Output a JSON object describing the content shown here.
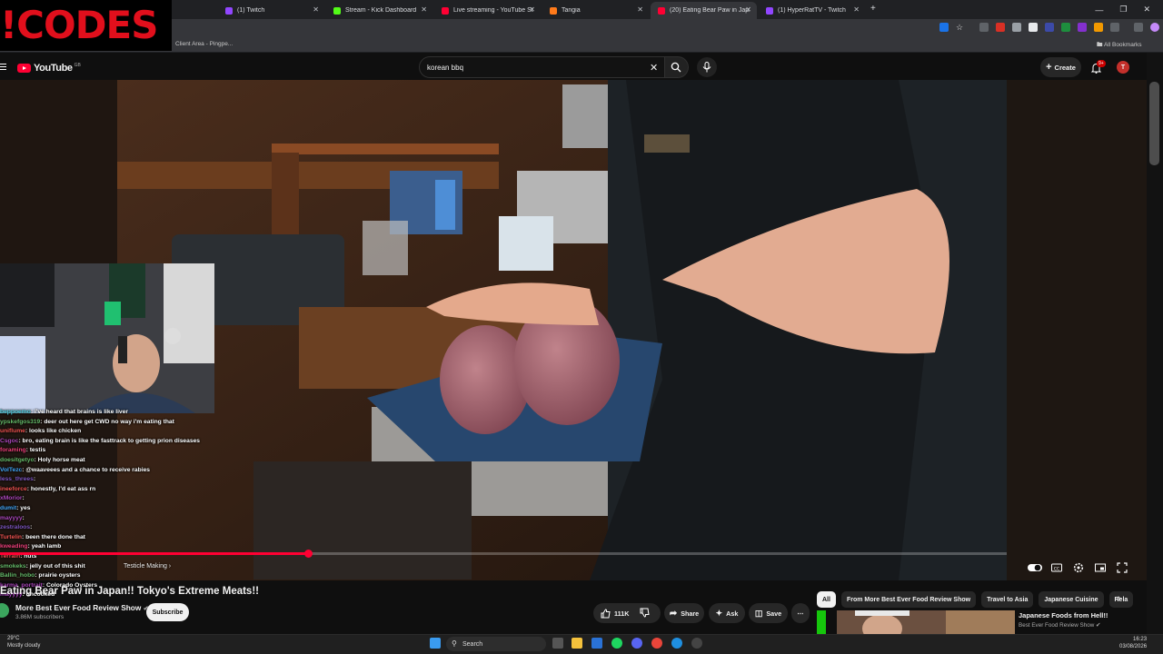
{
  "overlay": {
    "codes_text": "!CODES"
  },
  "browser": {
    "tabs": [
      {
        "label": "(1) Twitch",
        "color": "#9146ff",
        "active": false
      },
      {
        "label": "Stream - Kick Dashboard",
        "color": "#53fc18",
        "active": false
      },
      {
        "label": "Live streaming - YouTube Studio",
        "color": "#ff0033",
        "active": false
      },
      {
        "label": "Tangia",
        "color": "#ff7a1a",
        "active": false
      },
      {
        "label": "(20) Eating Bear Paw in Japa",
        "color": "#ff0033",
        "active": true
      },
      {
        "label": "(1) HyperRatTV - Twitch",
        "color": "#9146ff",
        "active": false
      }
    ],
    "new_tab": "+",
    "bookmark": "Client Area - Pingpe...",
    "all_bookmarks": "All Bookmarks"
  },
  "youtube": {
    "logo_text": "YouTube",
    "region": "GB",
    "search_value": "korean bbq",
    "create_label": "Create",
    "notif_count": "9+",
    "avatar_letter": "T"
  },
  "stream_overlay": {
    "chat": [
      {
        "user": "beppoemo",
        "ucolor": "#4dd0e1",
        "msg": "i've heard that brains is like liver"
      },
      {
        "user": "ypskefgos319",
        "ucolor": "#66bb6a",
        "msg": "deer out here get CWD no way i'm eating that"
      },
      {
        "user": "uniflume",
        "ucolor": "#ef5350",
        "msg": "looks like chicken"
      },
      {
        "user": "Csgoc",
        "ucolor": "#ab47bc",
        "msg": "bro, eating brain is like the fasttrack to getting prion diseases"
      },
      {
        "user": "foraming",
        "ucolor": "#ec407a",
        "msg": "testis"
      },
      {
        "user": "doesitgetyo",
        "ucolor": "#66bb6a",
        "msg": "Holy horse meat"
      },
      {
        "user": "VolTezc",
        "ucolor": "#42a5f5",
        "msg": "@waaveees and a chance to receive rabies"
      },
      {
        "user": "less_threes",
        "ucolor": "#7e57c2",
        "msg": ""
      },
      {
        "user": "ineeforce",
        "ucolor": "#ef5350",
        "msg": "honestly, I'd eat ass rn"
      },
      {
        "user": "xMorior",
        "ucolor": "#ab47bc",
        "msg": ""
      },
      {
        "user": "dumit",
        "ucolor": "#42a5f5",
        "msg": "yes"
      },
      {
        "user": "mayyyy",
        "ucolor": "#ab47bc",
        "msg": ""
      },
      {
        "user": "zestraloos",
        "ucolor": "#7e57c2",
        "msg": ""
      },
      {
        "user": "Turtelin",
        "ucolor": "#ef5350",
        "msg": "been there done that"
      },
      {
        "user": "kweading",
        "ucolor": "#ec407a",
        "msg": "yeah lamb"
      },
      {
        "user": "Terrain",
        "ucolor": "#ef5350",
        "msg": "nuts"
      },
      {
        "user": "smokeks",
        "ucolor": "#66bb6a",
        "msg": "jelly out of this shit"
      },
      {
        "user": "Ballin_hobo",
        "ucolor": "#66bb6a",
        "msg": "prairie oysters"
      },
      {
        "user": "karma_portrait",
        "ucolor": "#ab47bc",
        "msg": "Colorado Oysters"
      },
      {
        "user": "mayyyy",
        "ucolor": "#ab47bc",
        "msg": "uncooked"
      }
    ]
  },
  "player": {
    "chapter": "Testicle Making",
    "progress": 0.306
  },
  "video": {
    "title": "Eating Bear Paw in Japan!! Tokyo's Extreme Meats!!",
    "channel": "More Best Ever Food Review Show",
    "subscribers": "3.86M subscribers",
    "subscribe_label": "Subscribe",
    "likes": "111K",
    "share_label": "Share",
    "ask_label": "Ask",
    "save_label": "Save"
  },
  "chips": [
    "All",
    "From More Best Ever Food Review Show",
    "Travel to Asia",
    "Japanese Cuisine",
    "Rela"
  ],
  "recommended": {
    "title": "Japanese Foods from Hell!!",
    "channel": "Best Ever Food Review Show"
  },
  "taskbar": {
    "temp": "29°C",
    "weather": "Mostly cloudy",
    "search_label": "Search",
    "time": "16:23",
    "date": "03/08/2026"
  }
}
